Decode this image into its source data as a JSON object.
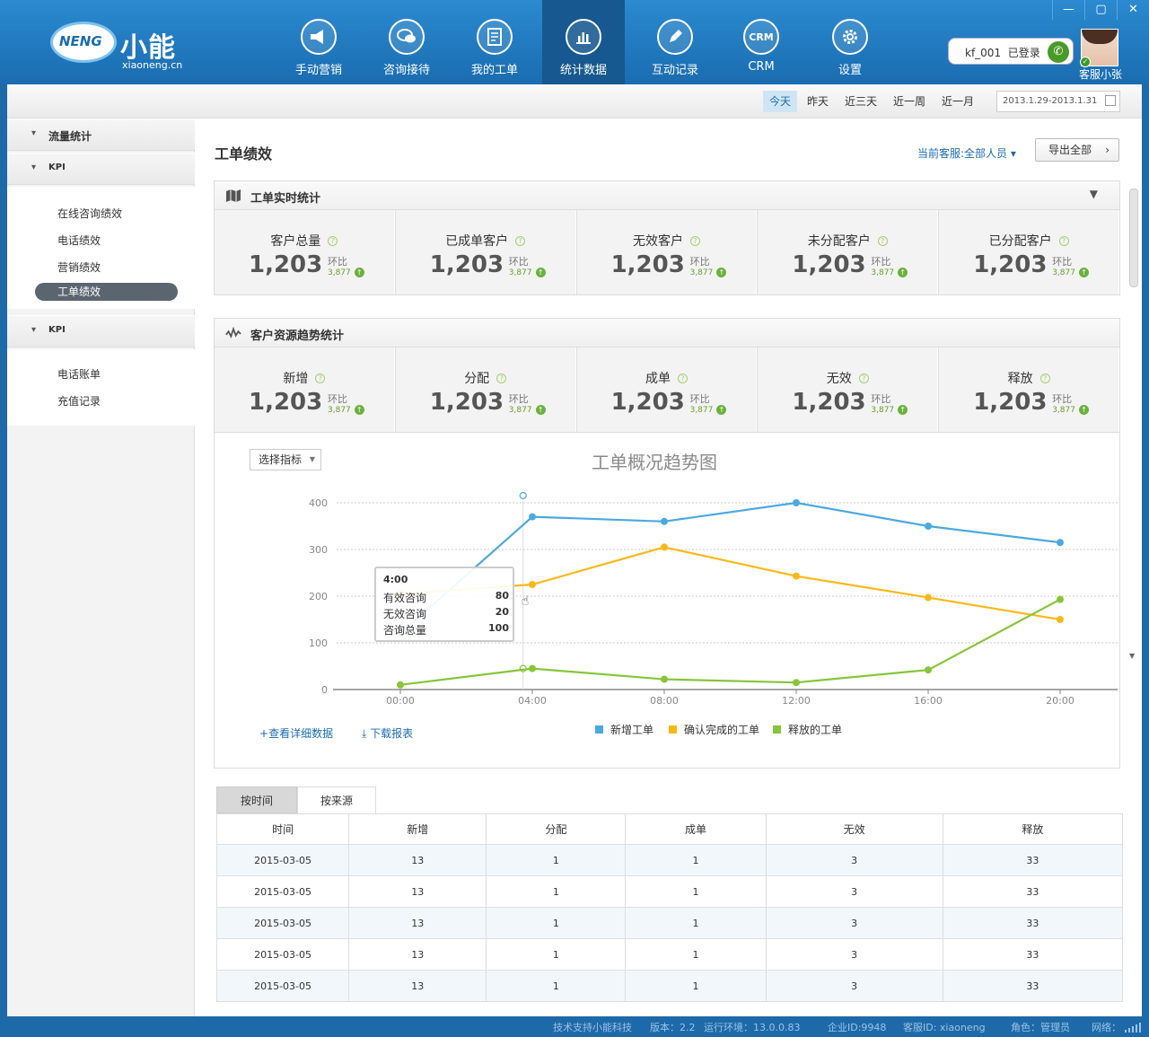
{
  "brand": {
    "name_cn": "小能",
    "name_en": "xiaoneng.cn",
    "badge": "NENG"
  },
  "nav": [
    {
      "label": "手动营销",
      "icon": "megaphone-icon"
    },
    {
      "label": "咨询接待",
      "icon": "chat-bubbles-icon"
    },
    {
      "label": "我的工单",
      "icon": "document-icon"
    },
    {
      "label": "统计数据",
      "icon": "bar-chart-icon"
    },
    {
      "label": "互动记录",
      "icon": "pencil-icon"
    },
    {
      "label": "CRM",
      "icon": "crm-icon",
      "badge": "CRM"
    },
    {
      "label": "设置",
      "icon": "gear-icon"
    }
  ],
  "active_nav": "统计数据",
  "window": {
    "min": "—",
    "max": "▢",
    "close": "✕"
  },
  "user": {
    "account": "kf_001",
    "status": "已登录",
    "name": "客服小张"
  },
  "datebar": {
    "buttons": [
      "今天",
      "昨天",
      "近三天",
      "近一周",
      "近一月"
    ],
    "active": "今天",
    "range": "2013.1.29-2013.1.31"
  },
  "sidebar": {
    "groups": [
      {
        "title": "流量统计",
        "items": []
      },
      {
        "title": "KPI",
        "items": [
          "在线咨询绩效",
          "电话绩效",
          "营销绩效",
          "工单绩效"
        ],
        "active": "工单绩效"
      },
      {
        "title": "KPI",
        "items": [
          "电话账单",
          "充值记录"
        ]
      }
    ]
  },
  "page": {
    "title": "工单绩效",
    "current_agent": "当前客服:全部人员",
    "export": "导出全部"
  },
  "realtime": {
    "title": "工单实时统计",
    "stats": [
      {
        "label": "客户总量",
        "value": "1,203",
        "ring_label": "环比",
        "ring_value": "3,877"
      },
      {
        "label": "已成单客户",
        "value": "1,203",
        "ring_label": "环比",
        "ring_value": "3,877"
      },
      {
        "label": "无效客户",
        "value": "1,203",
        "ring_label": "环比",
        "ring_value": "3,877"
      },
      {
        "label": "未分配客户",
        "value": "1,203",
        "ring_label": "环比",
        "ring_value": "3,877"
      },
      {
        "label": "已分配客户",
        "value": "1,203",
        "ring_label": "环比",
        "ring_value": "3,877"
      }
    ]
  },
  "trend": {
    "title": "客户资源趋势统计",
    "stats": [
      {
        "label": "新增",
        "value": "1,203",
        "ring_label": "环比",
        "ring_value": "3,877"
      },
      {
        "label": "分配",
        "value": "1,203",
        "ring_label": "环比",
        "ring_value": "3,877"
      },
      {
        "label": "成单",
        "value": "1,203",
        "ring_label": "环比",
        "ring_value": "3,877"
      },
      {
        "label": "无效",
        "value": "1,203",
        "ring_label": "环比",
        "ring_value": "3,877"
      },
      {
        "label": "释放",
        "value": "1,203",
        "ring_label": "环比",
        "ring_value": "3,877"
      }
    ]
  },
  "chart_controls": {
    "select_label": "选择指标",
    "detail_link": "查看详细数据",
    "download_link": "下载报表"
  },
  "chart_data": {
    "type": "line",
    "title": "工单概况趋势图",
    "x": [
      "00:00",
      "04:00",
      "08:00",
      "12:00",
      "16:00",
      "20:00"
    ],
    "ylim": [
      0,
      400
    ],
    "yticks": [
      0,
      100,
      200,
      300,
      400
    ],
    "grid": true,
    "legend_position": "bottom-center",
    "series": [
      {
        "name": "新增工单",
        "color": "#4aa9e0",
        "values": [
          120,
          370,
          360,
          400,
          350,
          315
        ]
      },
      {
        "name": "确认完成的工单",
        "color": "#f9b919",
        "values": [
          205,
          225,
          305,
          243,
          197,
          150
        ]
      },
      {
        "name": "释放的工单",
        "color": "#86c63a",
        "values": [
          10,
          45,
          22,
          15,
          42,
          193
        ]
      }
    ],
    "tooltip": {
      "title": "4:00",
      "rows": [
        {
          "label": "有效咨询",
          "value": "80"
        },
        {
          "label": "无效咨询",
          "value": "20"
        },
        {
          "label": "咨询总量",
          "value": "100"
        }
      ]
    }
  },
  "table": {
    "tabs": [
      "按时间",
      "按来源"
    ],
    "active_tab": "按时间",
    "columns": [
      "时间",
      "新增",
      "分配",
      "成单",
      "无效",
      "释放"
    ],
    "rows": [
      [
        "2015-03-05",
        "13",
        "1",
        "1",
        "3",
        "33"
      ],
      [
        "2015-03-05",
        "13",
        "1",
        "1",
        "3",
        "33"
      ],
      [
        "2015-03-05",
        "13",
        "1",
        "1",
        "3",
        "33"
      ],
      [
        "2015-03-05",
        "13",
        "1",
        "1",
        "3",
        "33"
      ],
      [
        "2015-03-05",
        "13",
        "1",
        "1",
        "3",
        "33"
      ]
    ]
  },
  "status": {
    "support": "技术支持小能科技",
    "version": "版本：2.2",
    "env": "运行环境：13.0.0.83",
    "company": "企业ID:9948",
    "agent_id": "客服ID: xiaoneng",
    "role": "角色：管理员",
    "network": "网络："
  }
}
